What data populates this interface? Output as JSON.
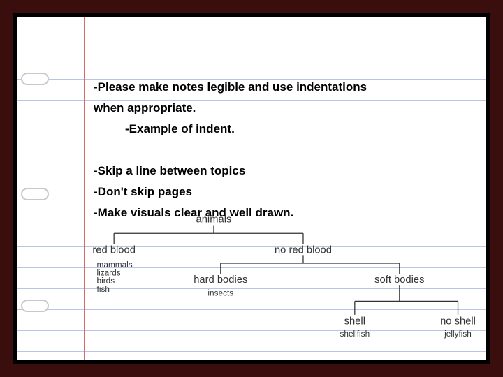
{
  "notes": {
    "line1": "-Please make notes legible and use indentations",
    "line2": "when appropriate.",
    "indent_example": "-Example of indent.",
    "line4": "-Skip a line between topics",
    "line5": "-Don't skip pages",
    "line6": "-Make visuals clear and well drawn."
  },
  "chart_data": {
    "type": "tree",
    "root": {
      "label": "animals",
      "children": [
        {
          "label": "red blood",
          "leaves": [
            "mammals",
            "lizards",
            "birds",
            "fish"
          ]
        },
        {
          "label": "no red blood",
          "children": [
            {
              "label": "hard bodies",
              "leaves": [
                "insects"
              ]
            },
            {
              "label": "soft bodies",
              "children": [
                {
                  "label": "shell",
                  "leaves": [
                    "shellfish"
                  ]
                },
                {
                  "label": "no shell",
                  "leaves": [
                    "jellyfish"
                  ]
                }
              ]
            }
          ]
        }
      ]
    }
  },
  "labels": {
    "animals": "animals",
    "red_blood": "red blood",
    "no_red_blood": "no red blood",
    "mammals": "mammals",
    "lizards": "lizards",
    "birds": "birds",
    "fish": "fish",
    "hard_bodies": "hard bodies",
    "soft_bodies": "soft bodies",
    "insects": "insects",
    "shell": "shell",
    "no_shell": "no shell",
    "shellfish": "shellfish",
    "jellyfish": "jellyfish"
  }
}
